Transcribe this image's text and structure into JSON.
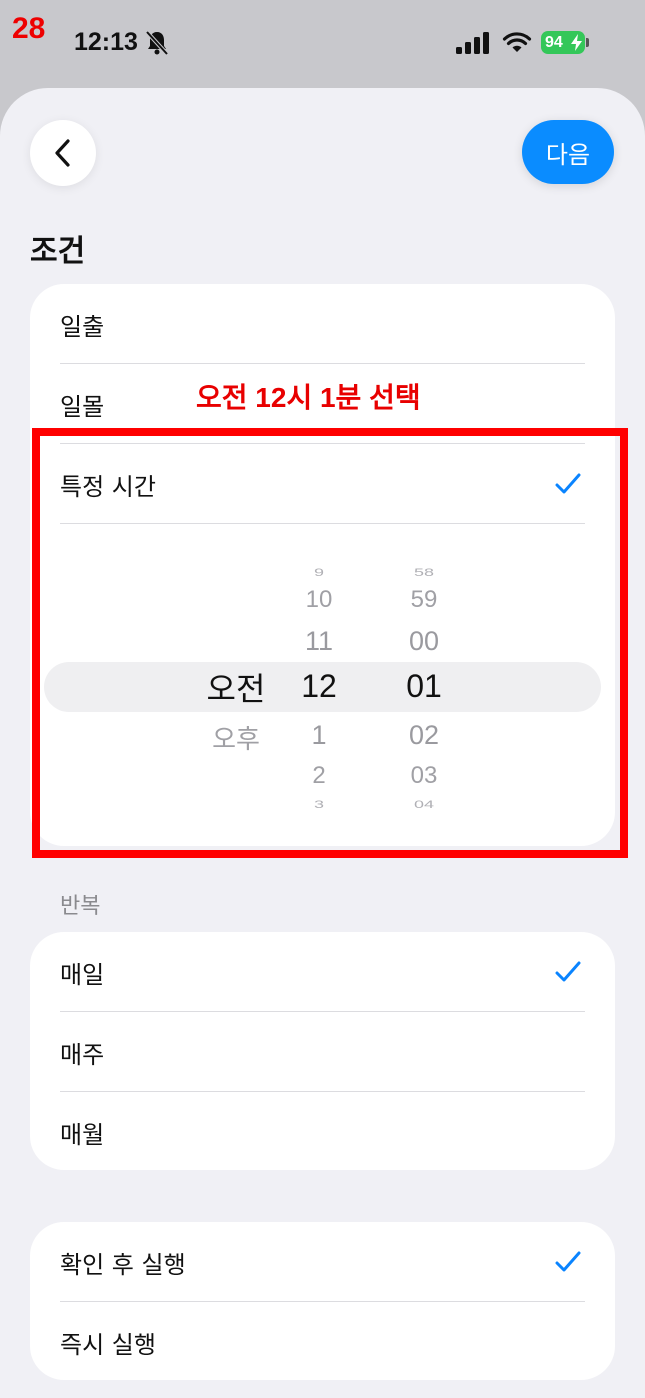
{
  "step_number": "28",
  "status": {
    "time": "12:13",
    "battery": "94"
  },
  "nav": {
    "next_label": "다음"
  },
  "section_title": "조건",
  "conditions": {
    "items": [
      {
        "label": "일출",
        "checked": false
      },
      {
        "label": "일몰",
        "checked": false
      },
      {
        "label": "특정 시간",
        "checked": true
      }
    ]
  },
  "picker": {
    "period": {
      "above": [],
      "selected": "오전",
      "below": [
        "오후"
      ]
    },
    "hour": {
      "above": [
        "9",
        "10",
        "11"
      ],
      "selected": "12",
      "below": [
        "1",
        "2",
        "3"
      ]
    },
    "minute": {
      "above": [
        "58",
        "59",
        "00"
      ],
      "selected": "01",
      "below": [
        "02",
        "03",
        "04"
      ]
    }
  },
  "repeat": {
    "label": "반복",
    "items": [
      {
        "label": "매일",
        "checked": true
      },
      {
        "label": "매주",
        "checked": false
      },
      {
        "label": "매월",
        "checked": false
      }
    ]
  },
  "execution": {
    "items": [
      {
        "label": "확인 후 실행",
        "checked": true
      },
      {
        "label": "즉시 실행",
        "checked": false
      }
    ]
  },
  "annotation": {
    "text": "오전 12시 1분 선택"
  },
  "colors": {
    "accent": "#0a8cff",
    "annotation": "#ff0000",
    "background": "#f0f0f5"
  }
}
